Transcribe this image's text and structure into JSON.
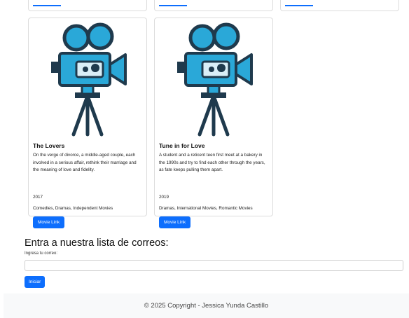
{
  "movies": [
    {
      "title": "The Lovers",
      "description": "On the verge of divorce, a middle-aged couple, each involved in a serious affair, rethink their marriage and the meaning of love and fidelity.",
      "year": "2017",
      "genres": "Comedies, Dramas, Independent Movies",
      "button_label": "Movie Link",
      "poster_icon": "movie-camera-icon"
    },
    {
      "title": "Tune in for Love",
      "description": "A student and a reticent teen first meet at a bakery in the 1990s and try to find each other through the years, as fate keeps pulling them apart.",
      "year": "2019",
      "genres": "Dramas, International Movies, Romantic Movies",
      "button_label": "Movie Link",
      "poster_icon": "movie-camera-icon"
    }
  ],
  "newsletter": {
    "title": "Entra a nuestra lista de correos:",
    "label": "Ingresa tu correo:",
    "email_value": "",
    "submit_label": "Iniciar"
  },
  "footer": {
    "text": "© 2025 Copyright - Jessica Yunda Castillo"
  },
  "colors": {
    "primary": "#0d6efd",
    "camera_body": "#2aa8d8",
    "camera_dark": "#1f3a4d",
    "footer_bg": "#f8f9fa"
  }
}
